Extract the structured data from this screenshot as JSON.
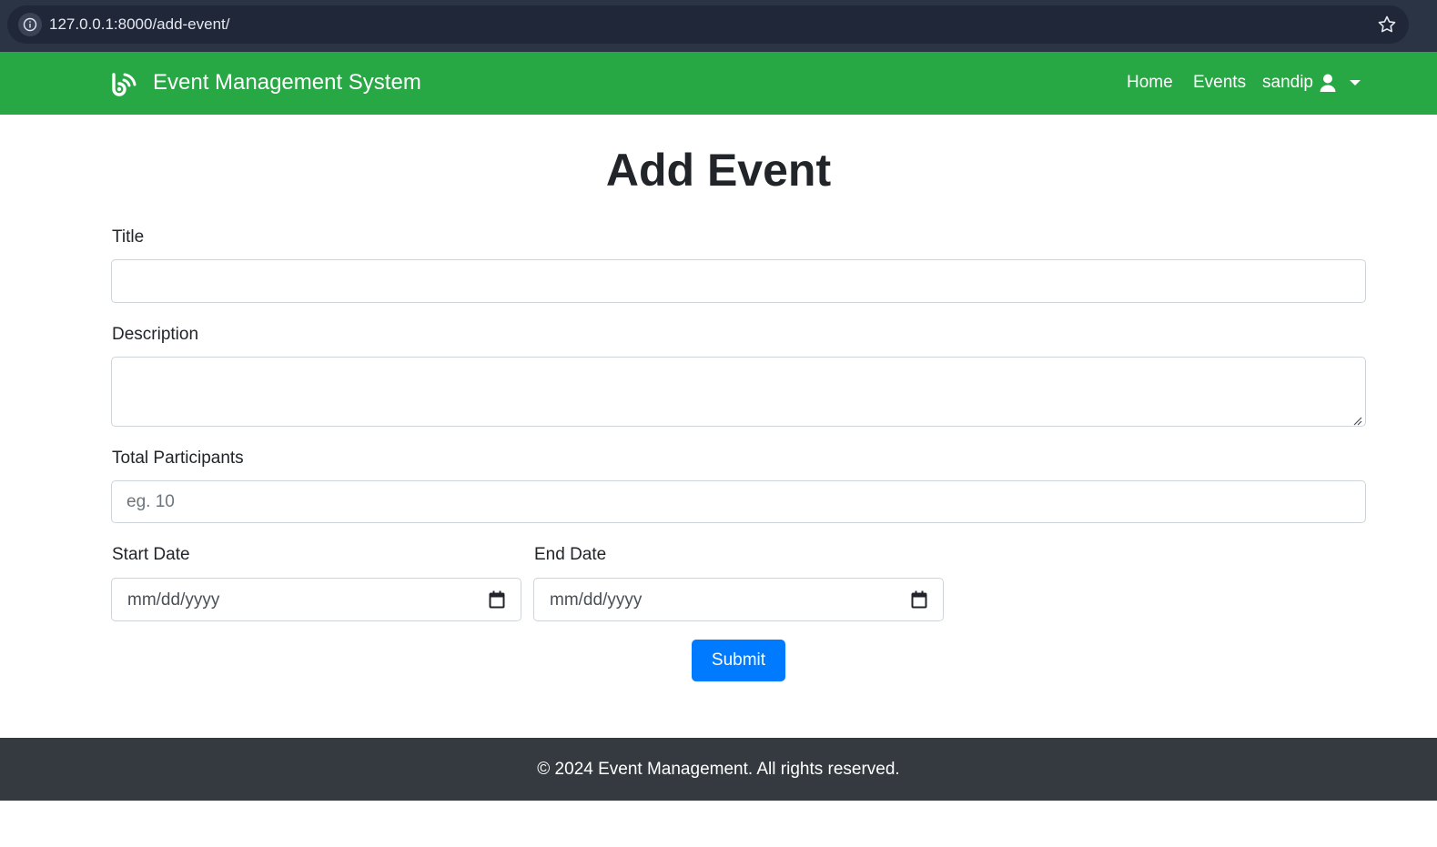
{
  "browser": {
    "url": "127.0.0.1:8000/add-event/"
  },
  "navbar": {
    "brand": "Event Management System",
    "home_label": "Home",
    "events_label": "Events",
    "user_label": "sandip",
    "bg_color": "#28a745"
  },
  "main": {
    "title": "Add Event",
    "title_label": "Title",
    "title_value": "",
    "description_label": "Description",
    "description_value": "",
    "participants_label": "Total Participants",
    "participants_placeholder": "eg. 10",
    "start_label": "Start Date",
    "start_value": "mm/dd/yyyy",
    "end_label": "End Date",
    "end_value": "mm/dd/yyyy",
    "submit_label": "Submit",
    "submit_color": "#007bff"
  },
  "footer": {
    "text": "© 2024 Event Management. All rights reserved."
  }
}
